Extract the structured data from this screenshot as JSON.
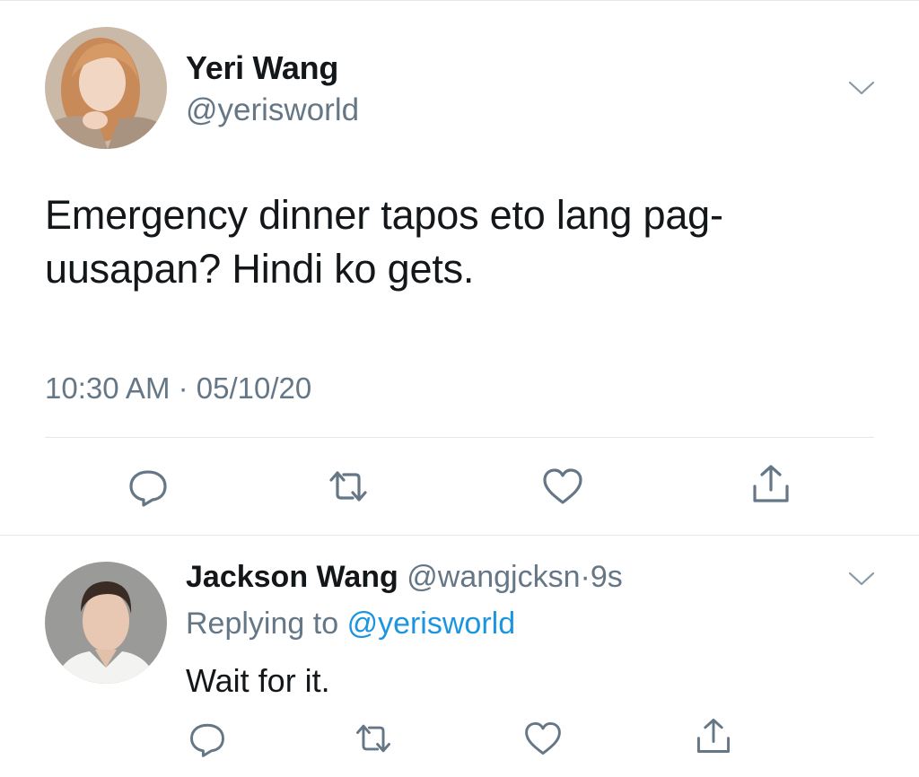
{
  "colors": {
    "text": "#14171a",
    "secondary": "#657786",
    "link": "#1b95e0",
    "divider": "#e1e8ed",
    "icon": "#657786"
  },
  "main_tweet": {
    "display_name": "Yeri Wang",
    "handle": "@yerisworld",
    "text": "Emergency dinner tapos eto lang pag-uusapan? Hindi ko gets.",
    "timestamp": "10:30 AM · 05/10/20",
    "icons": [
      "reply-icon",
      "retweet-icon",
      "like-icon",
      "share-icon",
      "chevron-down-icon"
    ]
  },
  "reply_tweet": {
    "display_name": "Jackson Wang",
    "handle": "@wangjcksn",
    "separator": "·",
    "time": "9s",
    "replying_label": "Replying to",
    "replying_to": "@yerisworld",
    "text": "Wait for it.",
    "icons": [
      "reply-icon",
      "retweet-icon",
      "like-icon",
      "share-icon",
      "chevron-down-icon"
    ]
  }
}
